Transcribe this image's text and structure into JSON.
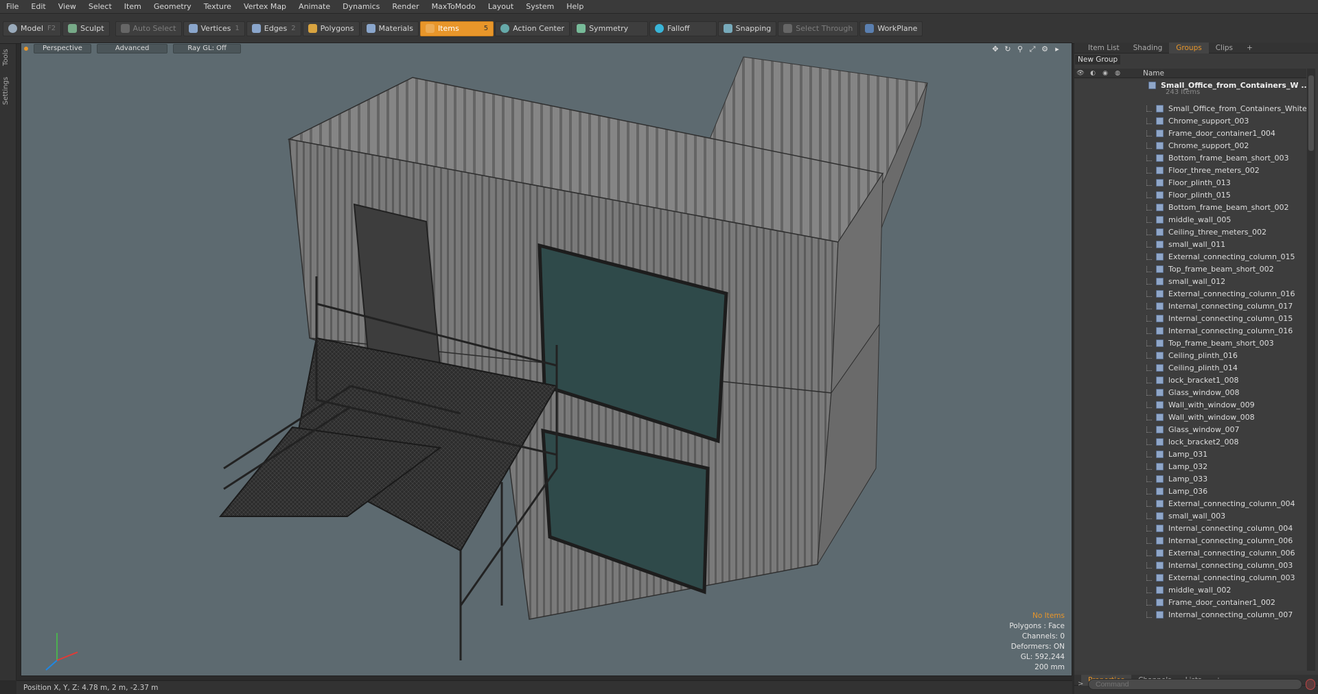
{
  "menu": [
    "File",
    "Edit",
    "View",
    "Select",
    "Item",
    "Geometry",
    "Texture",
    "Vertex Map",
    "Animate",
    "Dynamics",
    "Render",
    "MaxToModo",
    "Layout",
    "System",
    "Help"
  ],
  "toolbar": {
    "model": "Model",
    "model_key": "F2",
    "sculpt": "Sculpt",
    "auto_select": "Auto Select",
    "vertices": "Vertices",
    "vertices_key": "1",
    "edges": "Edges",
    "edges_key": "2",
    "polygons": "Polygons",
    "materials": "Materials",
    "items": "Items",
    "items_key": "5",
    "action_center": "Action Center",
    "symmetry": "Symmetry",
    "falloff": "Falloff",
    "snapping": "Snapping",
    "select_through": "Select Through",
    "workplane": "WorkPlane"
  },
  "left_tabs": [
    "Tools",
    "Settings"
  ],
  "viewport": {
    "view": "Perspective",
    "shading": "Advanced",
    "raygl": "Ray GL: Off",
    "info": {
      "selection": "No Items",
      "polygons": "Polygons : Face",
      "channels": "Channels: 0",
      "deformers": "Deformers: ON",
      "gl": "GL: 592,244",
      "scale": "200 mm"
    }
  },
  "status": {
    "position": "Position X, Y, Z:   4.78 m, 2 m, -2.37 m"
  },
  "right_panel": {
    "tabs": [
      "Item List",
      "Shading",
      "Groups",
      "Clips",
      "+"
    ],
    "active_tab": "Groups",
    "new_group": "New Group",
    "column_name": "Name",
    "root": {
      "name": "Small_Office_from_Containers_W ...",
      "count": "243 Items"
    },
    "items": [
      "Small_Office_from_Containers_White",
      "Chrome_support_003",
      "Frame_door_container1_004",
      "Chrome_support_002",
      "Bottom_frame_beam_short_003",
      "Floor_three_meters_002",
      "Floor_plinth_013",
      "Floor_plinth_015",
      "Bottom_frame_beam_short_002",
      "middle_wall_005",
      "Ceiling_three_meters_002",
      "small_wall_011",
      "External_connecting_column_015",
      "Top_frame_beam_short_002",
      "small_wall_012",
      "External_connecting_column_016",
      "Internal_connecting_column_017",
      "Internal_connecting_column_015",
      "Internal_connecting_column_016",
      "Top_frame_beam_short_003",
      "Ceiling_plinth_016",
      "Ceiling_plinth_014",
      "lock_bracket1_008",
      "Glass_window_008",
      "Wall_with_window_009",
      "Wall_with_window_008",
      "Glass_window_007",
      "lock_bracket2_008",
      "Lamp_031",
      "Lamp_032",
      "Lamp_033",
      "Lamp_036",
      "External_connecting_column_004",
      "small_wall_003",
      "Internal_connecting_column_004",
      "Internal_connecting_column_006",
      "External_connecting_column_006",
      "Internal_connecting_column_003",
      "External_connecting_column_003",
      "middle_wall_002",
      "Frame_door_container1_002",
      "Internal_connecting_column_007"
    ],
    "bottom_tabs": [
      "Properties",
      "Channels",
      "Lists",
      "+"
    ],
    "command_placeholder": "Command"
  },
  "colors": {
    "accent": "#e8962a",
    "viewport_bg": "#5d6a70",
    "panel_bg": "#3b3b3b"
  }
}
